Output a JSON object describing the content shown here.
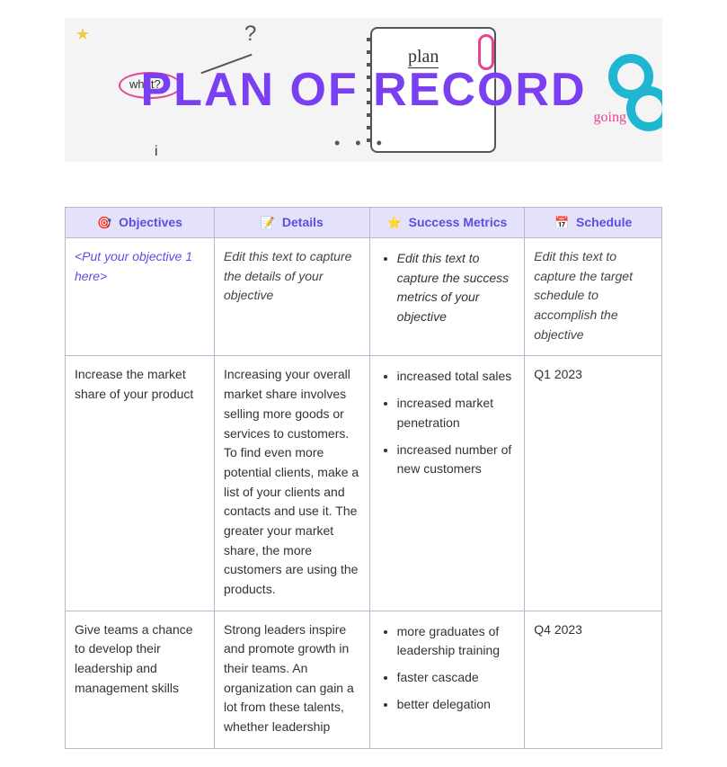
{
  "banner": {
    "title": "PLAN OF RECORD",
    "doodle_what": "what?",
    "doodle_plan": "plan",
    "doodle_going": "going"
  },
  "columns": [
    {
      "icon": "🎯",
      "label": "Objectives"
    },
    {
      "icon": "📝",
      "label": "Details"
    },
    {
      "icon": "⭐",
      "label": "Success Metrics"
    },
    {
      "icon": "📅",
      "label": "Schedule"
    }
  ],
  "rows": [
    {
      "objective": "<Put your objective 1 here>",
      "objective_placeholder": true,
      "details": "Edit this text to capture the details of your objective",
      "details_placeholder": true,
      "metrics": [
        "Edit this text to capture the success metrics of your objective"
      ],
      "metrics_placeholder": true,
      "schedule": "Edit this text to capture the target schedule to accomplish the objective",
      "schedule_placeholder": true
    },
    {
      "objective": "Increase the market share of your product",
      "details": "Increasing your overall market share involves selling more goods or services to customers. To find even more potential clients, make a list of your clients and contacts and use it. The greater your market share, the more customers are using the products.",
      "metrics": [
        "increased total sales",
        "increased market penetration",
        "increased number of new customers"
      ],
      "schedule": "Q1 2023"
    },
    {
      "objective": "Give teams a chance to develop their leadership and management skills",
      "details": "Strong leaders inspire and promote growth in their teams. An organization can gain a lot from these talents, whether leadership",
      "metrics": [
        "more graduates of leadership training",
        "faster cascade",
        "better delegation"
      ],
      "schedule": "Q4 2023"
    }
  ]
}
